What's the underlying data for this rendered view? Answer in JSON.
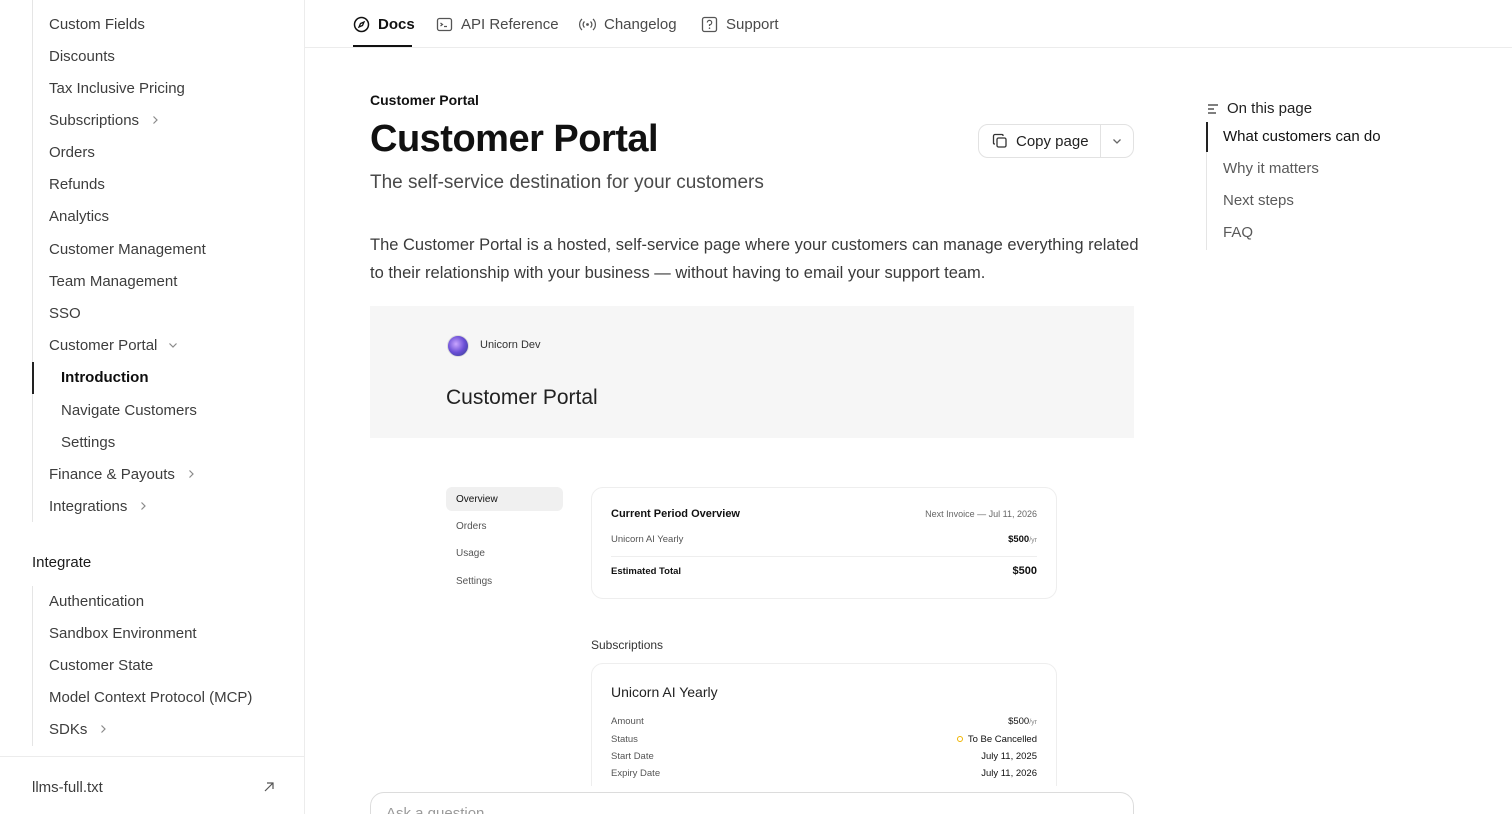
{
  "sidebar": {
    "items_top": [
      {
        "label": "Custom Fields",
        "chevron": false
      },
      {
        "label": "Discounts",
        "chevron": false
      },
      {
        "label": "Tax Inclusive Pricing",
        "chevron": false
      },
      {
        "label": "Subscriptions",
        "chevron": "right"
      },
      {
        "label": "Orders",
        "chevron": false
      },
      {
        "label": "Refunds",
        "chevron": false
      },
      {
        "label": "Analytics",
        "chevron": false
      },
      {
        "label": "Customer Management",
        "chevron": false
      },
      {
        "label": "Team Management",
        "chevron": false
      },
      {
        "label": "SSO",
        "chevron": false
      },
      {
        "label": "Customer Portal",
        "chevron": "down"
      }
    ],
    "portal_children": [
      "Introduction",
      "Navigate Customers",
      "Settings"
    ],
    "items_after": [
      {
        "label": "Finance & Payouts"
      },
      {
        "label": "Integrations"
      }
    ],
    "integrate_heading": "Integrate",
    "integrate_items": [
      {
        "label": "Authentication"
      },
      {
        "label": "Sandbox Environment"
      },
      {
        "label": "Customer State"
      },
      {
        "label": "Model Context Protocol (MCP)"
      },
      {
        "label": "SDKs"
      }
    ],
    "footer_links": [
      "llms-full.txt"
    ]
  },
  "tabs": [
    {
      "label": "Docs",
      "icon": "compass-icon"
    },
    {
      "label": "API Reference",
      "icon": "terminal-icon"
    },
    {
      "label": "Changelog",
      "icon": "broadcast-icon"
    },
    {
      "label": "Support",
      "icon": "help-icon"
    }
  ],
  "page": {
    "eyebrow": "Customer Portal",
    "title": "Customer Portal",
    "subtitle": "The self-service destination for your customers",
    "copy_label": "Copy page",
    "paragraph": "The Customer Portal is a hosted, self-service page where your customers can manage everything related to their relationship with your business — without having to email your support team."
  },
  "mock": {
    "brand": "Unicorn Dev",
    "title": "Customer Portal",
    "nav": [
      "Overview",
      "Orders",
      "Usage",
      "Settings"
    ],
    "overview": {
      "heading": "Current Period Overview",
      "next_invoice": "Next Invoice — Jul 11, 2026",
      "line_label": "Unicorn AI Yearly",
      "line_value": "$500",
      "line_unit": "/yr",
      "total_label": "Estimated Total",
      "total_value": "$500"
    },
    "subscriptions_label": "Subscriptions",
    "subscription": {
      "name": "Unicorn AI Yearly",
      "amount_label": "Amount",
      "amount_value": "$500",
      "amount_unit": "/yr",
      "status_label": "Status",
      "status_value": "To Be Cancelled",
      "start_label": "Start Date",
      "start_value": "July 11, 2025",
      "expiry_label": "Expiry Date",
      "expiry_value": "July 11, 2026"
    }
  },
  "ask": {
    "placeholder": "Ask a question..."
  },
  "toc": {
    "heading": "On this page",
    "items": [
      "What customers can do",
      "Why it matters",
      "Next steps",
      "FAQ"
    ]
  }
}
